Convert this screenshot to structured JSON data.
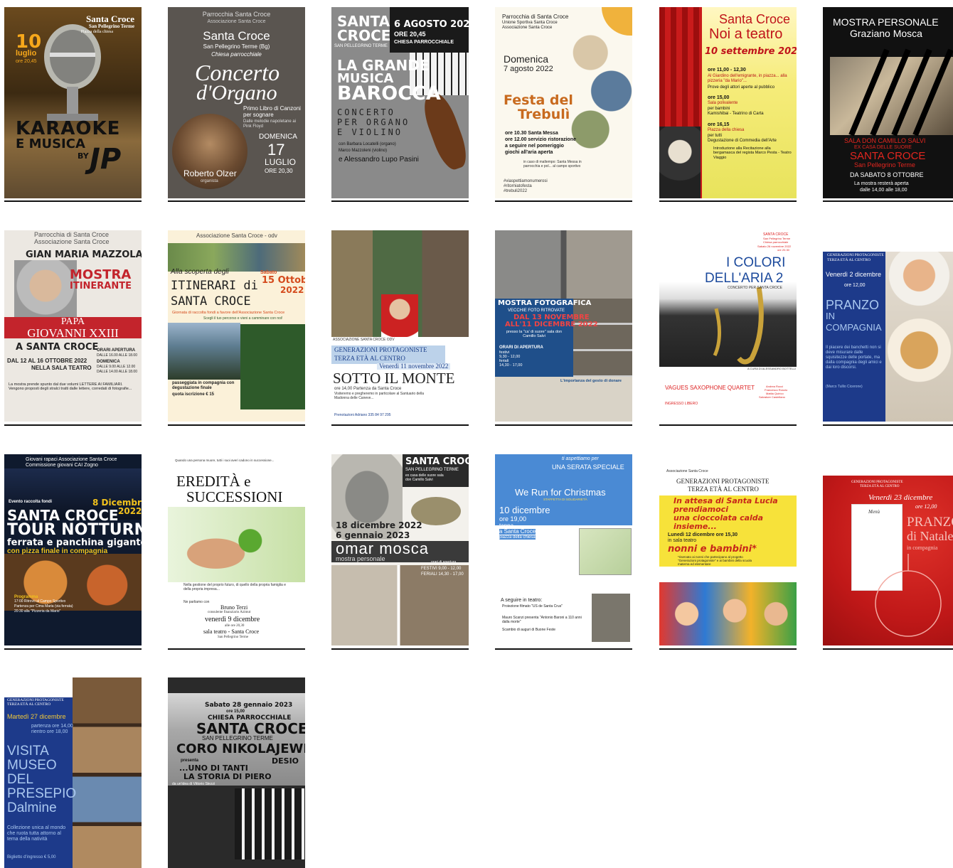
{
  "posters": [
    {
      "title": "Santa Croce",
      "subtitle": "San Pellegrino Terme",
      "place": "Piazza della chiesa",
      "day": "10",
      "month": "luglio",
      "time": "ore 20,45",
      "main": "KARAOKE",
      "main2": "E MUSICA",
      "by": "BY",
      "brand": "JP"
    },
    {
      "header": "Parrocchia Santa Croce",
      "header2": "Associazione Santa Croce",
      "title": "Santa Croce",
      "subtitle": "San Pellegrino Terme (Bg)",
      "place": "Chiesa parrocchiale",
      "main": "Concerto",
      "main2": "d'Organo",
      "program": "Primo Libro di Canzoni per sognare",
      "program2": "Dalle melodie napoletane ai Pink Floyd",
      "weekday": "DOMENICA",
      "day": "17",
      "month": "LUGLIO",
      "time": "ORE 20,30",
      "performer": "Roberto Olzer",
      "role": "organista"
    },
    {
      "title": "SANTA",
      "title2": "CROCE",
      "town": "SAN PELLEGRINO TERME",
      "date": "6 AGOSTO 2022",
      "time": "ORE 20,45",
      "place": "CHIESA PARROCCHIALE",
      "main": "LA GRANDE",
      "main2": "MUSICA",
      "main3": "BAROCCA",
      "sub": "CONCERTO",
      "sub2": "PER ORGANO",
      "sub3": "E VIOLINO",
      "performers": "con Barbara Locatelli (organo)",
      "performers2": "Marco Mazzoleni (violino)",
      "performers3": "e Alessandro Lupo Pasini"
    },
    {
      "header": "Parrocchia di Santa Croce",
      "header2": "Unione Sportiva Santa Croce",
      "header3": "Associazione Santa Croce",
      "weekday": "Domenica",
      "date": "7 agosto 2022",
      "main": "Festa del",
      "main2": "Trebulì",
      "line1": "ore 10.30 Santa Messa",
      "line2": "ore 12.00 servizio ristorazione",
      "line3": "a seguire nel pomeriggio",
      "line4": "giochi all'aria aperta",
      "rain": "in caso di maltempo: Santa Messa in parrocchia e pol... al campo sportivo",
      "tags": "#viaspettiamonumerosi",
      "tags2": "#ritorniatofesta",
      "tags3": "#trebuli2022"
    },
    {
      "title": "Santa Croce",
      "main": "Noi a teatro",
      "date": "10 settembre 2022",
      "s1_time": "ore 11,00 - 12,30",
      "s1_text": "Al Giardino dell'emigrante, in piazza... alla pizzeria \"da Mario\"...",
      "s1_text2": "Prove degli attori aperte al pubblico",
      "s2_time": "ore 15,00",
      "s2_text": "Sala polivalente",
      "s2_text2": "per bambini",
      "s2_text3": "Kamishibai - Teatrino di Carta",
      "s3_time": "ore 16,15",
      "s3_text": "Piazza della chiesa",
      "s3_text2": "per tutti",
      "s3_text3": "Degustazione di Commedia dell'Arte",
      "s3_text4": "Introduzione alla Recitazione alla bergamasca del regista Marco Pesta - Teatro Viaggio"
    },
    {
      "title": "MOSTRA PERSONALE",
      "name": "Graziano Mosca",
      "place": "SALA DON CAMILLO SALVI",
      "place2": "EX CASA DELLE SUORE",
      "main": "SANTA CROCE",
      "town": "San Pellegrino Terme",
      "date": "DA SABATO 8 OTTOBRE",
      "hours": "La mostra resterà aperta",
      "hours2": "dalle 14,00 alle 18,00"
    },
    {
      "header": "Parrocchia di Santa Croce",
      "header2": "Associazione Santa Croce",
      "name": "GIAN MARIA MAZZOLA",
      "main": "MOSTRA",
      "main2": "ITINERANTE",
      "pope": "PAPA",
      "pope2": "GIOVANNI XXIII",
      "place": "A SANTA CROCE",
      "date": "DAL 12 AL 16 OTTOBRE 2022",
      "room": "NELLA SALA TEATRO",
      "hours": "ORARI APERTURA",
      "hours2": "DALLE 16.00 ALLE 18.00",
      "hours3": "DOMENICA",
      "hours4": "DALLE 9.00 ALLE 12.00",
      "hours5": "DALLE 14.00 ALLE 18.00",
      "desc": "La mostra prende spunto dal due volumi LETTERE AI FAMILIARI. Vengono proposti degli stralci tratti dalle lettere, corredati di fotografie..."
    },
    {
      "header": "Associazione Santa Croce - odv",
      "intro": "Alla scoperta degli",
      "main": "ITINERARI di",
      "main2": "SANTA CROCE",
      "day": "Sabato",
      "date": "15 Ottobre",
      "year": "2022",
      "note": "Giornata di raccolta fondi a favore dell'Associazione Santa Croce",
      "note2": "Scegli il tuo percorso e vieni a camminare con noi!",
      "walk": "passeggiata in compagnia con degustazione finale",
      "fee": "quota iscrizione € 15"
    },
    {
      "assoc": "ASSOCIAZIONE SANTA CROCE ODV",
      "header": "GENERAZIONI PROTAGONISTE",
      "header2": "TERZA ETÀ AL CENTRO",
      "date": "Venerdì 11 novembre 2022",
      "main": "SOTTO IL MONTE",
      "desc": "ore 14,00 Partenza da Santa Croce",
      "desc2": "Visiteremo e pregheremo in particolare al Santuario della Madonna delle Caneve...",
      "booking": "Prenotazioni Adriano 335 84 97 295"
    },
    {
      "main": "MOSTRA FOTOGRAFICA",
      "sub": "VECCHIE FOTO RITROVATE",
      "date": "DAL 13 NOVEMBRE",
      "date2": "ALL'11 DICEMBRE 2022",
      "place": "presso la \"ca' di suore\" sala don Camillo Salvi",
      "hours": "ORARI DI APERTURA",
      "hours2": "festivi",
      "hours3": "9,30 - 12,00",
      "hours4": "feriali",
      "hours5": "14,30 - 17,00",
      "note": "L'importanza del gesto di donare"
    },
    {
      "header": "SANTA CROCE",
      "header2": "San Pellegrino Terme",
      "header3": "Chiesa parrocchiale",
      "header4": "Sabato 26 novembre 2022",
      "header5": "ore 20.30",
      "main": "I COLORI",
      "main2": "DELL'ARIA 2",
      "sub": "CONCERTO PER SANTA CROCE",
      "credit": "A CURA DI ALESSANDRO BOTTELLI",
      "quartet": "VAGUES SAXOPHONE QUARTET",
      "names": "Andrea Rocci",
      "names2": "Francesco Ronzio",
      "names3": "Mattia Quirico",
      "names4": "Salvatore Castellano",
      "entry": "INGRESSO LIBERO"
    },
    {
      "header": "GENERAZIONI PROTAGONISTE",
      "header2": "TERZA ETÀ AL CENTRO",
      "date": "Venerdì 2 dicembre",
      "time": "ore 12,00",
      "main": "PRANZO",
      "main2": "IN",
      "main3": "COMPAGNIA",
      "quote": "Il piacere dei banchetti non si deve misurare dalle squisitezze delle portate, ma dalla compagnia degli amici e dai loro discorsi.",
      "author": "(Marco Tullio Cicerone)"
    },
    {
      "header": "Giovani rapaci Associazione Santa Croce",
      "header2": "Commissione giovani CAI Zogno",
      "event": "Evento raccolta fondi",
      "date": "8 Dicembre",
      "year": "2022",
      "main": "SANTA CROCE",
      "main2": "TOUR NOTTURNO",
      "sub": "ferrata e panchina gigante",
      "sub2": "con pizza finale in compagnia",
      "prog": "Programma",
      "prog2": "17:00 Ritrovo al Campo Sportivo",
      "prog3": "Partenza per Cima Maria (via ferrata)",
      "prog4": "20:30 alla \"Pizzeria da Mario\""
    },
    {
      "intro": "Quando una persona muore, tutti i suoi averi cadono in successione...",
      "main": "EREDITÀ e",
      "main2": "SUCCESSIONI",
      "desc": "Nella gestione del proprio futuro, di quello della propria famiglia e della propria impresa...",
      "desc2": "Ne parliamo con",
      "speaker": "Bruno Terzi",
      "role": "consulente finanziario Azimut",
      "date": "venerdì 9 dicembre",
      "time": "alle ore 20,30",
      "place": "sala teatro - Santa Croce",
      "town": "San Pellegrino Terme"
    },
    {
      "title": "SANTA CROCE",
      "town": "SAN PELLEGRINO TERME",
      "place": "ex casa delle suore sala don Camillo Salvi",
      "date": "18 dicembre 2022",
      "date2": "6 gennaio 2023",
      "main": "omar mosca",
      "sub": "mostra personale",
      "hours": "orari di apertura",
      "hours2": "FESTIVI  9,00 - 12,00",
      "hours3": "FERIALI 14,30 - 17,00"
    },
    {
      "header": "ti aspettiamo per",
      "header2": "UNA SERATA SPECIALE",
      "main": "We Run for Christmas",
      "sub": "STAFFETTA DI SOLIDARIETÀ",
      "date": "10 dicembre",
      "time": "ore 19,00",
      "stop": "tappa",
      "stop2": "a Santa Croce",
      "stop3": "piazza della chiesa",
      "follow": "A seguire in teatro:",
      "follow2": "Proiezione filmato \"US de Santa Crus\"",
      "follow3": "Mauro Scanzi presenta \"Antonio Baroni a 110 anni dalla morte\"",
      "follow4": "Scambio di auguri di Buone Feste"
    },
    {
      "assoc": "Associazione Santa Croce",
      "header": "GENERAZIONI PROTAGONISTE",
      "header2": "TERZA ETÀ AL CENTRO",
      "main": "In attesa di Santa Lucia",
      "main2": "prendiamoci",
      "main3": "una cioccolata calda",
      "main4": "insieme...",
      "date": "Lunedì 12 dicembre ore 15,30",
      "place": "in sala teatro",
      "who": "nonni e bambini*",
      "note": "*riservato ai nonni che partecipano al progetto \"Generazioni protagoniste\" e ai bambini della scuola materna ed elementare"
    },
    {
      "header": "GENERAZIONI PROTAGONISTE",
      "header2": "TERZA ETÀ AL CENTRO",
      "date": "Venerdì 23 dicembre",
      "time": "ore 12,00",
      "menu": "Menù",
      "main": "PRANZO",
      "main2": "di Natale",
      "sub": "in compagnia"
    },
    {
      "header": "GENERAZIONI PROTAGONISTE",
      "header2": "TERZA ETÀ AL CENTRO",
      "date": "Martedì 27 dicembre",
      "time": "partenza ore 14,00",
      "time2": "rientro ore 18,00",
      "main": "VISITA",
      "main2": "MUSEO",
      "main3": "DEL",
      "main4": "PRESEPIO",
      "main5": "Dalmine",
      "desc": "Collezione unica al mondo che ruota tutta attorno al tema della natività",
      "ticket": "Biglietto d'ingresso € 5,00"
    },
    {
      "date": "Sabato 28 gennaio 2023",
      "time": "ore 15,00",
      "place": "CHIESA PARROCCHIALE",
      "main": "SANTA CROCE",
      "town": "SAN PELLEGRINO TERME",
      "choir": "CORO NIKOLAJEWKA",
      "choir2": "DESIO",
      "presents": "presenta",
      "show": "...UNO DI TANTI",
      "show2": "LA STORIA DI PIERO",
      "author": "da un'idea di Vittorio Stezzi"
    }
  ]
}
